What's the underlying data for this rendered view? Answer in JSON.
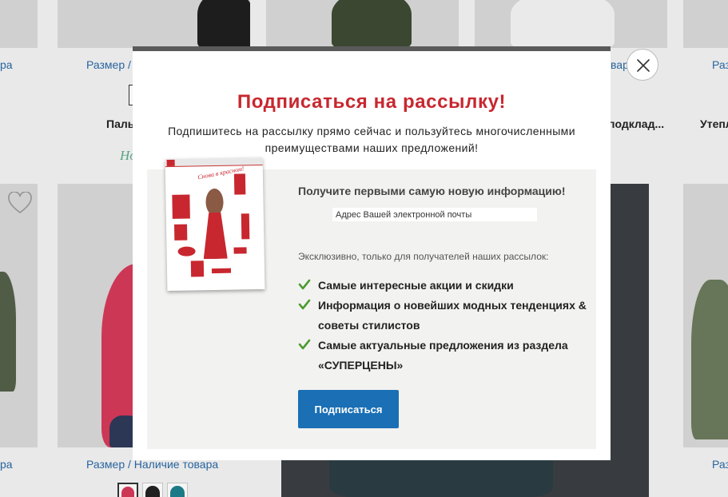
{
  "background": {
    "size_availability_label": "Размер / Наличие товара",
    "top_size_links": [
      "ра",
      "Размер /",
      "вар",
      "Разм"
    ],
    "bottom_size_links": [
      "ра",
      "Размер / Наличие товара",
      "Разм"
    ],
    "product_names": [
      "Паль",
      "подклад...",
      "Утепл"
    ],
    "novelty_badge": "Но"
  },
  "modal": {
    "title": "Подписаться на рассылку!",
    "subtitle": "Подпишитесь на рассылку прямо сейчас и пользуйтесь многочисленными преимуществами наших предложений!",
    "info_heading": "Получите первыми самую новую информацию!",
    "email_placeholder": "Адрес Вашей электронной почты",
    "exclusive_text": "Эксклюзивно, только для получателей наших рассылок:",
    "benefits": [
      "Самые интересные акции и скидки",
      "Информация о новейших модных тенденциях & советы стилистов",
      "Самые актуальные предложения из раздела «СУПЕРЦЕНЫ»"
    ],
    "subscribe_label": "Подписаться",
    "catalog_caption": "Снова в красном!"
  },
  "colors": {
    "title_red": "#c8272f",
    "button_blue": "#1a6fb5",
    "check_green": "#4a9a2e",
    "link_blue": "#2a69a6"
  },
  "icons": {
    "close": "close-icon",
    "favorite": "heart-icon",
    "benefit": "checkmark-icon"
  }
}
